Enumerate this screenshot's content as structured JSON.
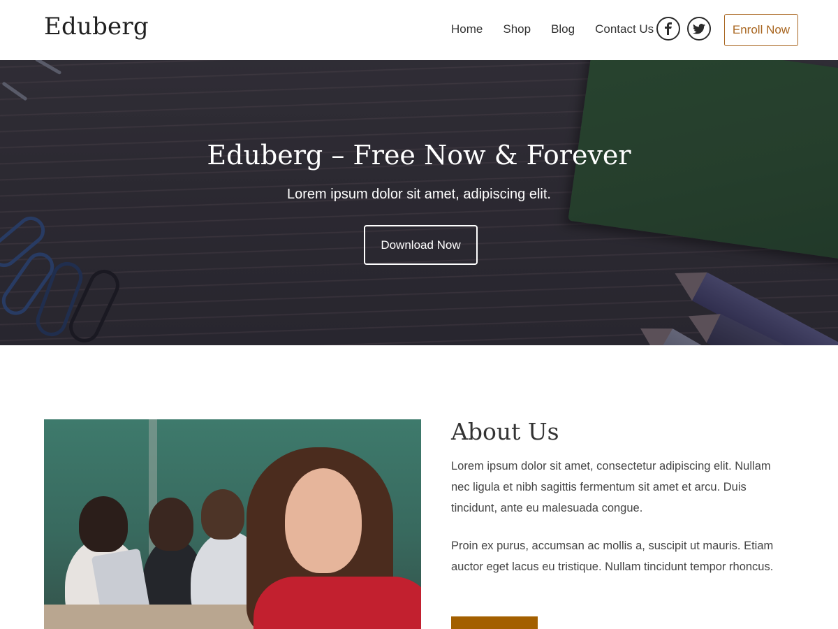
{
  "header": {
    "logo": "Eduberg",
    "nav": [
      "Home",
      "Shop",
      "Blog",
      "Contact Us"
    ],
    "social": [
      "facebook-icon",
      "twitter-icon"
    ],
    "cta": "Enroll Now"
  },
  "hero": {
    "title": "Eduberg – Free Now & Forever",
    "subtitle": "Lorem ipsum dolor sit amet, adipiscing elit.",
    "button": "Download Now"
  },
  "about": {
    "title": "About Us",
    "paragraph1": "Lorem ipsum dolor sit amet, consectetur adipiscing elit. Nullam nec ligula et nibh sagittis fermentum sit amet et arcu. Duis tincidunt, ante eu malesuada congue.",
    "paragraph2": "Proin ex purus, accumsan ac mollis a, suscipit ut mauris. Etiam auctor eget lacus eu tristique. Nullam tincidunt tempor rhoncus."
  },
  "colors": {
    "accent": "#a8651f",
    "button_fill": "#a35f00",
    "text": "#333333"
  }
}
